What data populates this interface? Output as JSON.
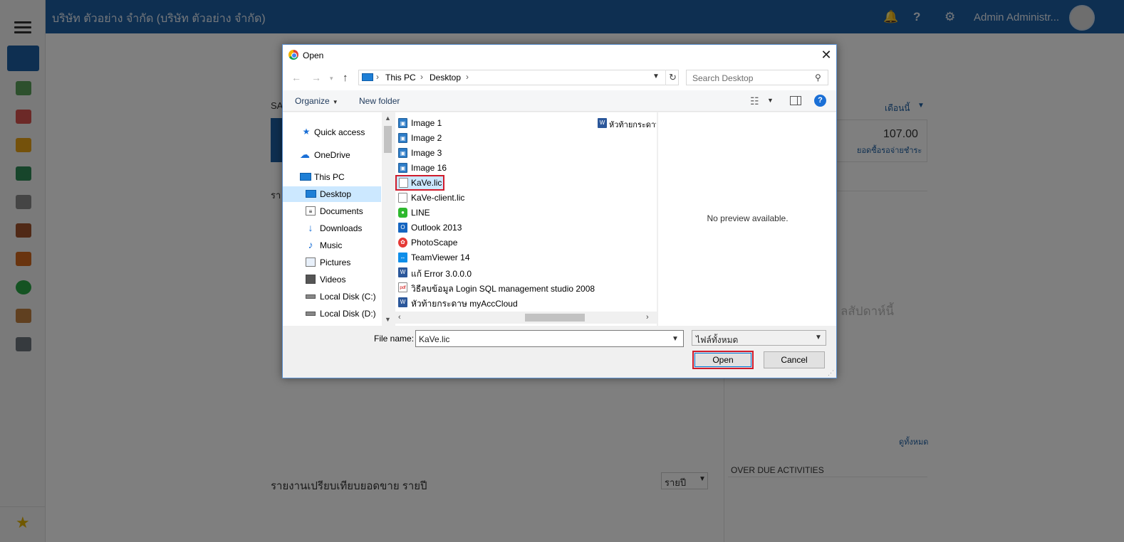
{
  "app": {
    "company_name": "บริษัท ตัวอย่าง จำกัด (บริษัท ตัวอย่าง จำกัด)",
    "user_name": "Admin Administr...",
    "bg_section_a": "SA",
    "bg_section_r": "รา",
    "period_label": "เดือนนี้",
    "amount": "107.00",
    "amount_caption": "ยอดซื้อรอจ่ายชำระ",
    "week_text": "ลสัปดาห์นี้",
    "view_all": "ดูทั้งหมด",
    "overdue_title": "OVER DUE ACTIVITIES",
    "compare_title": "รายงานเปรียบเทียบยอดขาย รายปี",
    "year_select": "รายปี"
  },
  "dialog": {
    "title": "Open",
    "breadcrumb": [
      "This PC",
      "Desktop"
    ],
    "search_placeholder": "Search Desktop",
    "organize_label": "Organize",
    "new_folder_label": "New folder",
    "help_glyph": "?",
    "nav_items": [
      {
        "label": "Quick access",
        "icon": "star-pin-icon"
      },
      {
        "label": "OneDrive",
        "icon": "cloud-icon"
      },
      {
        "label": "This PC",
        "icon": "computer-icon"
      },
      {
        "label": "Desktop",
        "icon": "desktop-icon",
        "selected": true
      },
      {
        "label": "Documents",
        "icon": "documents-icon"
      },
      {
        "label": "Downloads",
        "icon": "download-arrow-icon"
      },
      {
        "label": "Music",
        "icon": "music-note-icon"
      },
      {
        "label": "Pictures",
        "icon": "pictures-icon"
      },
      {
        "label": "Videos",
        "icon": "film-icon"
      },
      {
        "label": "Local Disk (C:)",
        "icon": "drive-icon"
      },
      {
        "label": "Local Disk (D:)",
        "icon": "drive-icon"
      }
    ],
    "files": [
      {
        "name": "Image 1",
        "icon": "image-file-icon"
      },
      {
        "name": "Image 2",
        "icon": "image-file-icon"
      },
      {
        "name": "Image 3",
        "icon": "image-file-icon"
      },
      {
        "name": "Image 16",
        "icon": "image-file-icon"
      },
      {
        "name": "KaVe.lic",
        "icon": "blank-file-icon",
        "selected": true
      },
      {
        "name": "KaVe-client.lic",
        "icon": "blank-file-icon"
      },
      {
        "name": "LINE",
        "icon": "line-app-icon"
      },
      {
        "name": "Outlook 2013",
        "icon": "outlook-icon"
      },
      {
        "name": "PhotoScape",
        "icon": "photoscape-icon"
      },
      {
        "name": "TeamViewer 14",
        "icon": "teamviewer-icon"
      },
      {
        "name": "แก้ Error 3.0.0.0",
        "icon": "word-doc-icon"
      },
      {
        "name": "วิธีลบข้อมูล Login SQL management studio 2008",
        "icon": "pdf-file-icon"
      },
      {
        "name": "หัวท้ายกระดาษ myAccCloud",
        "icon": "word-doc-icon"
      }
    ],
    "files_col2": [
      {
        "name": "หัวท้ายกระดาษ",
        "icon": "word-doc-icon"
      }
    ],
    "preview_text": "No preview available.",
    "file_name_label": "File name:",
    "file_name_value": "KaVe.lic",
    "file_type_value": "ไฟล์ทั้งหมด",
    "open_label": "Open",
    "cancel_label": "Cancel"
  },
  "colors": {
    "topbar": "#1d5fa3",
    "highlight": "#d01c2c",
    "selection": "#cce8ff"
  }
}
